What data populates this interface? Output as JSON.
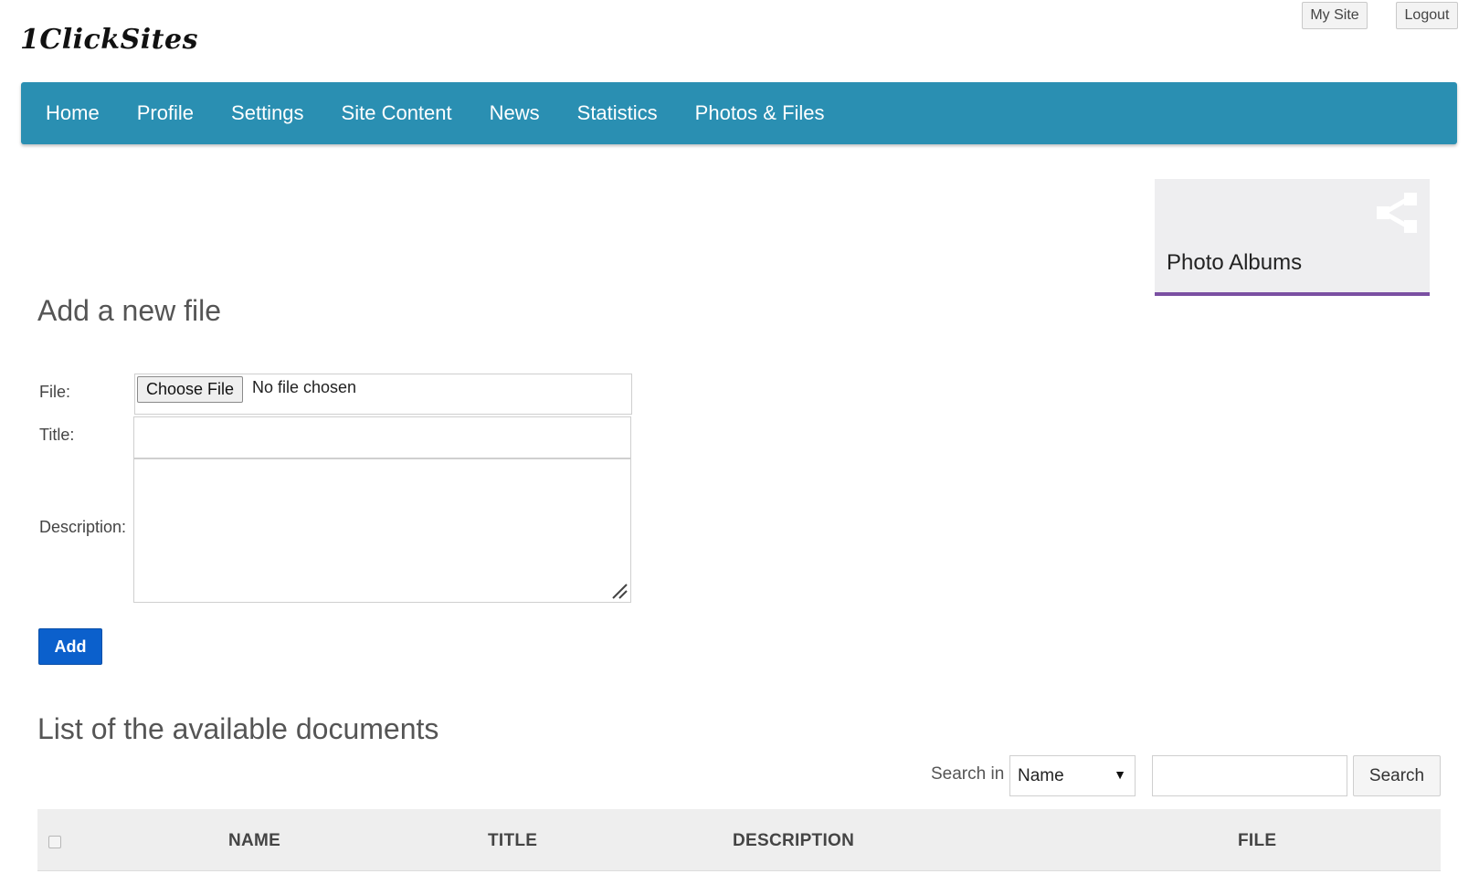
{
  "brand": {
    "logo_text": "1ClickSites"
  },
  "top_bar": {
    "my_site_label": "My Site",
    "logout_label": "Logout"
  },
  "nav": {
    "items": [
      "Home",
      "Profile",
      "Settings",
      "Site Content",
      "News",
      "Statistics",
      "Photos & Files"
    ],
    "background_color": "#2a8fb2"
  },
  "album_card": {
    "label": "Photo Albums",
    "icon": "share-icon",
    "accent_color": "#7a4fa2"
  },
  "add_file": {
    "heading": "Add a new file",
    "file_label": "File:",
    "choose_file_label": "Choose File",
    "no_file_text": "No file chosen",
    "title_label": "Title:",
    "title_value": "",
    "description_label": "Description:",
    "description_value": "",
    "add_button_label": "Add",
    "add_button_color": "#0b60cc"
  },
  "documents": {
    "heading": "List of the available documents",
    "search_in_label": "Search in",
    "search_field_selected": "Name",
    "search_query": "",
    "search_button_label": "Search",
    "columns": [
      "Name",
      "Title",
      "Description",
      "File"
    ],
    "rows": []
  }
}
